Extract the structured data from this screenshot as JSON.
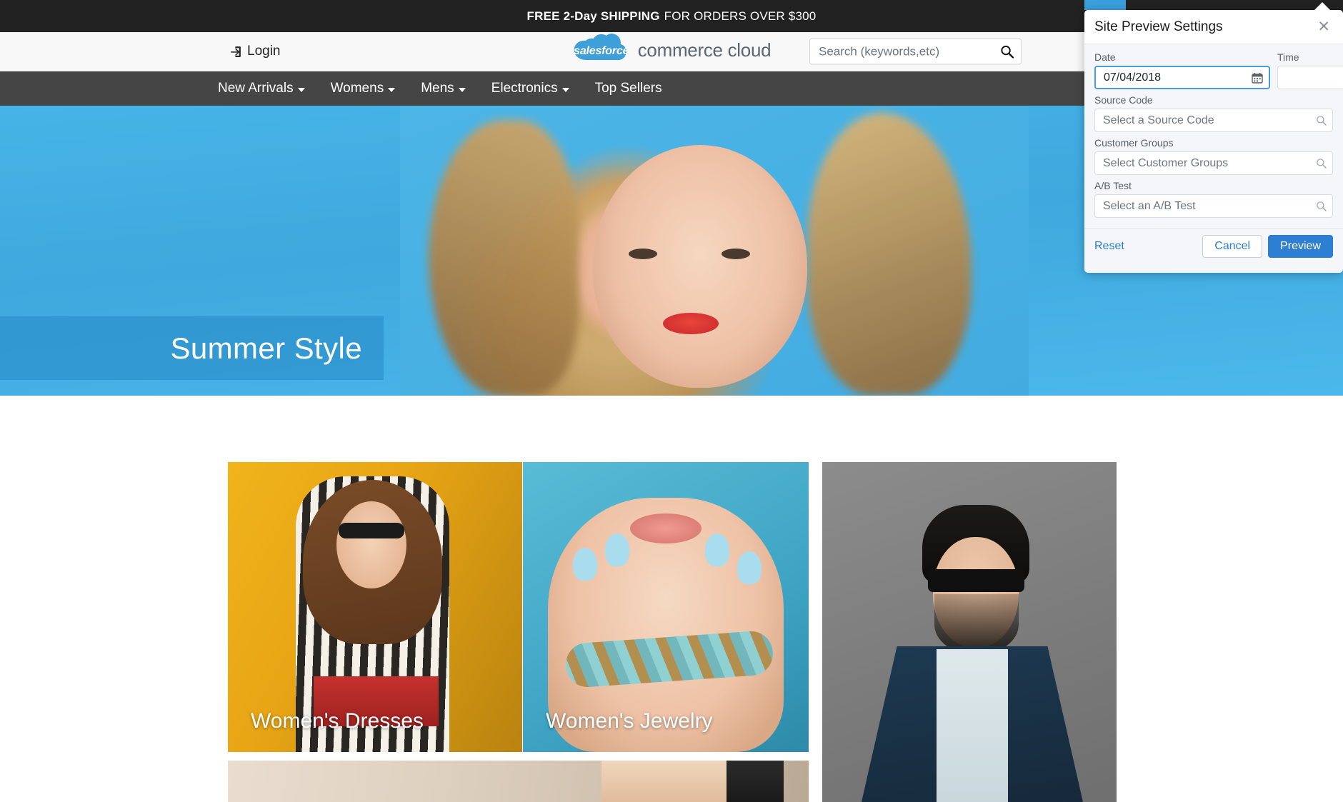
{
  "promo": {
    "bold_text": "FREE 2-Day SHIPPING",
    "rest_text": "FOR ORDERS OVER $300"
  },
  "header": {
    "login_label": "Login",
    "login_icon": "sign-in-icon",
    "brand_badge_text": "salesforce",
    "brand_text": "commerce cloud",
    "search_placeholder": "Search (keywords,etc)",
    "search_value": "",
    "search_icon": "search-icon",
    "cart_icon": "cart-icon"
  },
  "nav": {
    "items": [
      {
        "label": "New Arrivals",
        "has_caret": true
      },
      {
        "label": "Womens",
        "has_caret": true
      },
      {
        "label": "Mens",
        "has_caret": true
      },
      {
        "label": "Electronics",
        "has_caret": true
      },
      {
        "label": "Top Sellers",
        "has_caret": false
      }
    ]
  },
  "hero": {
    "headline": "Summer Style"
  },
  "tiles": [
    {
      "caption": "Women's Dresses"
    },
    {
      "caption": "Women's Jewelry"
    },
    {
      "caption": ""
    }
  ],
  "site_preview": {
    "title": "Site Preview Settings",
    "close_icon": "close-icon",
    "fields": {
      "date_label": "Date",
      "date_value": "07/04/2018",
      "date_icon": "calendar-icon",
      "time_label": "Time",
      "time_value": "",
      "time_placeholder": "",
      "source_code_label": "Source Code",
      "source_code_placeholder": "Select a Source Code",
      "source_code_value": "",
      "customer_groups_label": "Customer Groups",
      "customer_groups_placeholder": "Select Customer Groups",
      "customer_groups_value": "",
      "ab_test_label": "A/B Test",
      "ab_test_placeholder": "Select an A/B Test",
      "ab_test_value": "",
      "lookup_icon": "search-icon"
    },
    "buttons": {
      "reset": "Reset",
      "cancel": "Cancel",
      "preview": "Preview"
    }
  },
  "colors": {
    "promo_bg": "#222222",
    "nav_bg": "#454545",
    "hero_blue": "#45b2e5",
    "brand_blue": "#3aa0dd",
    "primary_button": "#2d7fd3",
    "link_blue": "#2a7fd4"
  }
}
